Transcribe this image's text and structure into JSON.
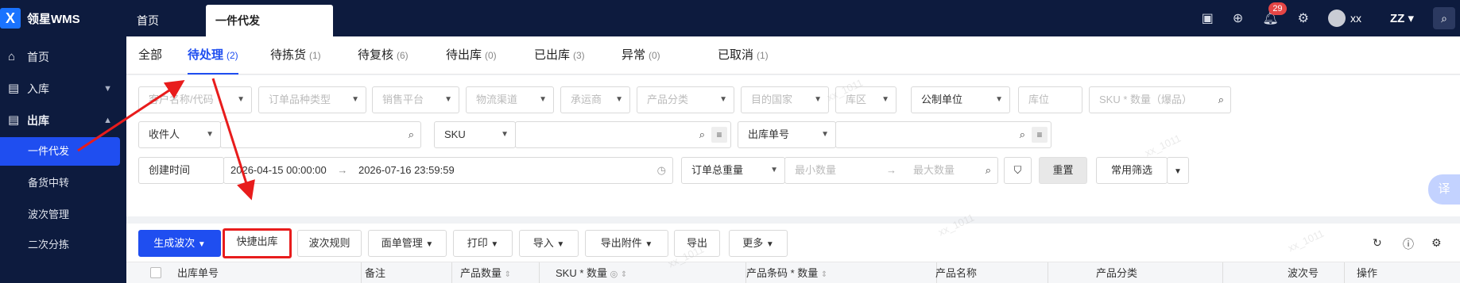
{
  "app": {
    "logo_glyph": "X",
    "title": "领星WMS"
  },
  "top_tabs": {
    "home": "首页",
    "active": "一件代发"
  },
  "header": {
    "notif_count": "29",
    "user_name": "xx",
    "org": "ZZ",
    "icons": [
      "inbox-icon",
      "download-icon",
      "bell-icon",
      "settings-icon",
      "avatar",
      "search-icon"
    ]
  },
  "sidebar": {
    "home": "首页",
    "inbound": "入库",
    "outbound": "出库",
    "subs": [
      "一件代发",
      "备货中转",
      "波次管理",
      "二次分拣"
    ]
  },
  "status_tabs": [
    {
      "label": "全部",
      "count": ""
    },
    {
      "label": "待处理",
      "count": "(2)"
    },
    {
      "label": "待拣货",
      "count": "(1)"
    },
    {
      "label": "待复核",
      "count": "(6)"
    },
    {
      "label": "待出库",
      "count": "(0)"
    },
    {
      "label": "已出库",
      "count": "(3)"
    },
    {
      "label": "异常",
      "count": "(0)"
    },
    {
      "label": "已取消",
      "count": "(1)"
    }
  ],
  "filters": {
    "row1": [
      "客户名称/代码",
      "订单品种类型",
      "销售平台",
      "物流渠道",
      "承运商",
      "产品分类",
      "目的国家",
      "库区",
      "公制单位",
      "库位",
      "SKU * 数量（爆品）"
    ],
    "receiver": "收件人",
    "sku": "SKU",
    "order_no": "出库单号",
    "created_time": "创建时间",
    "date_start": "2026-04-15 00:00:00",
    "date_sep": "→",
    "date_end": "2026-07-16 23:59:59",
    "weight": "订单总重量",
    "min": "最小数量",
    "max": "最大数量",
    "reset": "重置",
    "common": "常用筛选"
  },
  "toolbar": {
    "generate_wave": "生成波次",
    "quick_out": "快捷出库",
    "wave_rules": "波次规则",
    "label_mgmt": "面单管理",
    "print": "打印",
    "import": "导入",
    "export_attach": "导出附件",
    "export": "导出",
    "more": "更多"
  },
  "table": {
    "columns": [
      "出库单号",
      "备注",
      "产品数量",
      "SKU * 数量",
      "产品条码 * 数量",
      "产品名称",
      "产品分类",
      "波次号",
      "操作"
    ]
  },
  "watermark": "xx_1011",
  "translate_btn": "译",
  "colors": {
    "nav": "#0d1b3e",
    "primary": "#1f4ef0",
    "annotation": "#e81c1c"
  }
}
